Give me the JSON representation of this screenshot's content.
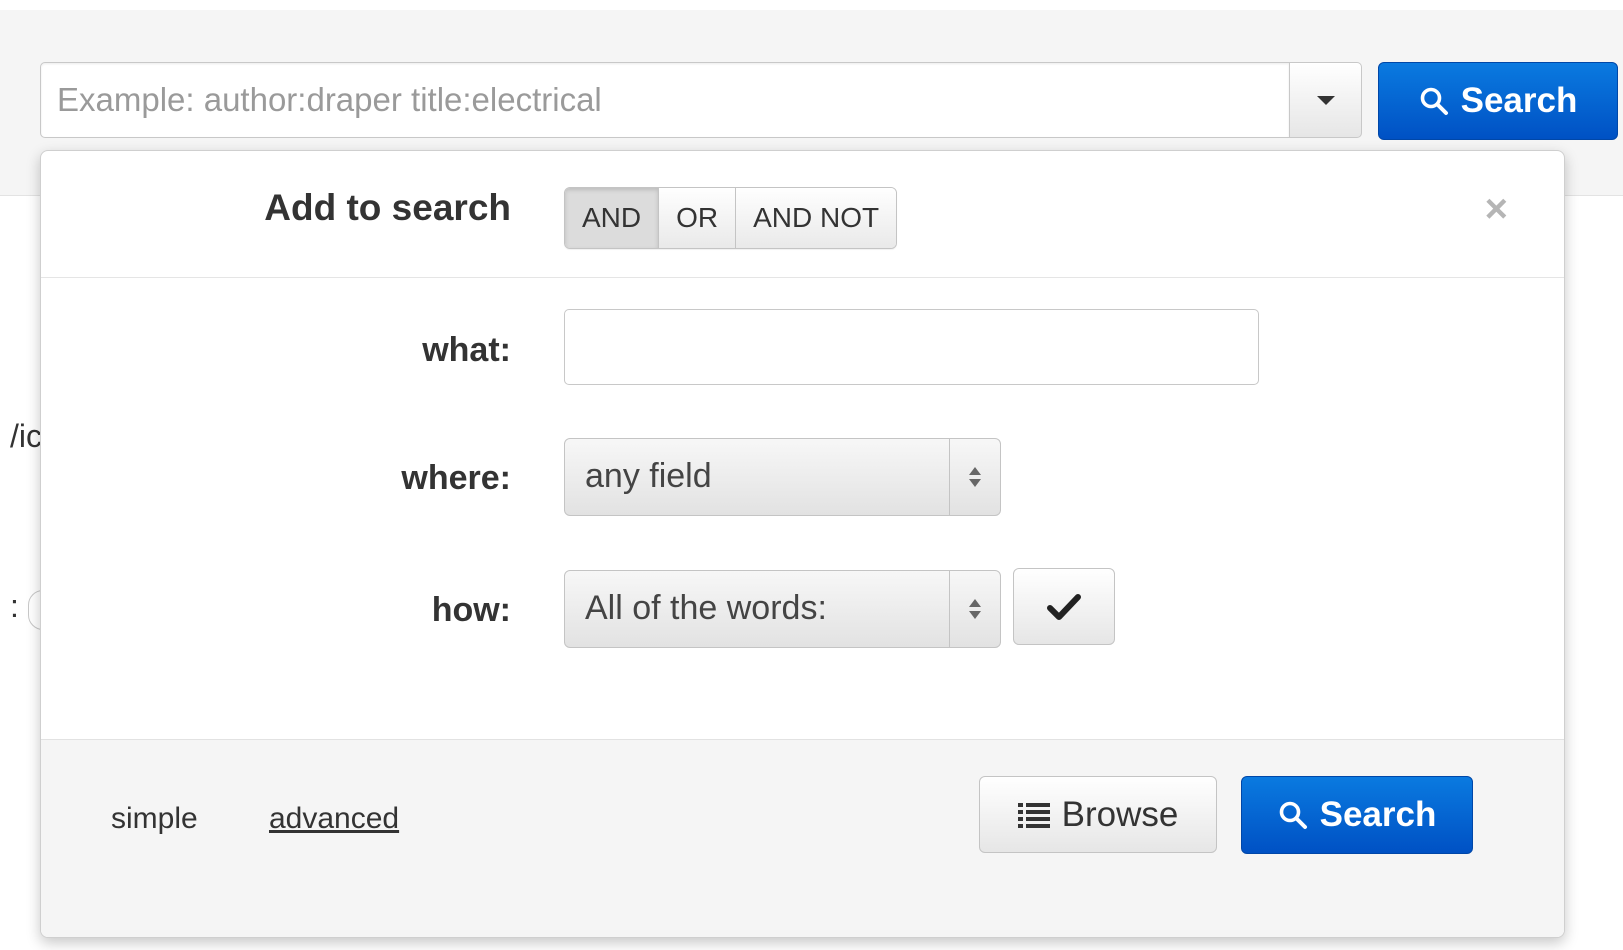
{
  "search": {
    "placeholder": "Example: author:draper title:electrical",
    "button_label": "Search"
  },
  "background_fragments": {
    "fragment_1": "/ic",
    "fragment_2": ":"
  },
  "panel": {
    "header_label": "Add to search",
    "boolean_ops": [
      "AND",
      "OR",
      "AND NOT"
    ],
    "active_op": "AND",
    "close_symbol": "×",
    "what_label": "what:",
    "what_value": "",
    "where_label": "where:",
    "where_value": "any field",
    "how_label": "how:",
    "how_value": "All of the words:"
  },
  "footer": {
    "simple_label": "simple",
    "advanced_label": "advanced",
    "browse_label": "Browse",
    "search_label": "Search"
  },
  "colors": {
    "primary": "#0061d2",
    "panel_bg": "#ffffff",
    "footer_bg": "#f5f5f5"
  },
  "icons": {
    "search_button_icon": "search-icon",
    "browse_icon": "list-icon",
    "confirm_icon": "checkmark-icon",
    "dropdown_icon": "caret-down-icon"
  }
}
